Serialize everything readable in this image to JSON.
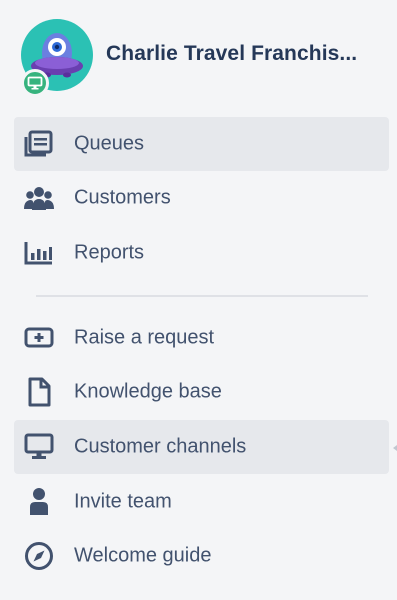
{
  "project": {
    "name": "Charlie Travel Franchis...",
    "avatar_icon": "monster-avatar-icon",
    "badge_icon": "monitor-icon",
    "avatar_color": "#2bc1b4",
    "badge_color": "#36b37e"
  },
  "nav": {
    "primary": [
      {
        "label": "Queues",
        "icon": "queues-icon",
        "active": true
      },
      {
        "label": "Customers",
        "icon": "customers-icon",
        "active": false
      },
      {
        "label": "Reports",
        "icon": "reports-icon",
        "active": false
      }
    ],
    "secondary": [
      {
        "label": "Raise a request",
        "icon": "add-request-icon",
        "active": false
      },
      {
        "label": "Knowledge base",
        "icon": "document-icon",
        "active": false
      },
      {
        "label": "Customer channels",
        "icon": "monitor-icon",
        "active": true
      },
      {
        "label": "Invite team",
        "icon": "person-icon",
        "active": false
      },
      {
        "label": "Welcome guide",
        "icon": "compass-icon",
        "active": false
      }
    ]
  },
  "colors": {
    "background": "#f4f5f7",
    "active_background": "#e6e8ec",
    "text": "#42526e",
    "title": "#253858"
  }
}
